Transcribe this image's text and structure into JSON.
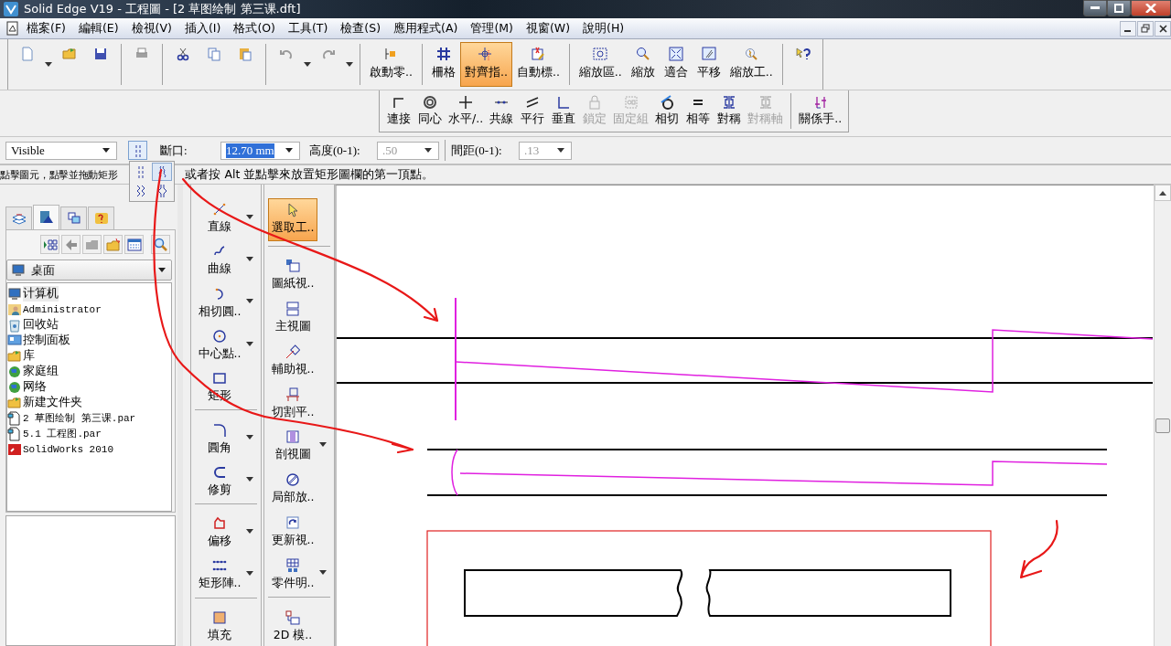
{
  "window": {
    "title": "Solid Edge V19 - 工程圖 - [2 草图绘制 第三课.dft]"
  },
  "menu": [
    "檔案(F)",
    "編輯(E)",
    "檢視(V)",
    "插入(I)",
    "格式(O)",
    "工具(T)",
    "檢查(S)",
    "應用程式(A)",
    "管理(M)",
    "視窗(W)",
    "說明(H)"
  ],
  "toolbar": [
    {
      "kind": "page",
      "dropdown": true,
      "selected": false
    },
    {
      "kind": "folder",
      "selected": false
    },
    {
      "kind": "disk",
      "selected": false
    },
    {
      "kind": "sep"
    },
    {
      "kind": "printer",
      "selected": false
    },
    {
      "kind": "sep"
    },
    {
      "kind": "scissors",
      "selected": false
    },
    {
      "kind": "copy",
      "selected": false
    },
    {
      "kind": "paste",
      "selected": false
    },
    {
      "kind": "sep"
    },
    {
      "kind": "undo",
      "dropdown": true,
      "selected": false
    },
    {
      "kind": "redo",
      "dropdown": true,
      "selected": false
    },
    {
      "kind": "sep"
    },
    {
      "kind": "flag",
      "label": "啟動零..",
      "selected": false
    },
    {
      "kind": "sep"
    },
    {
      "kind": "grid",
      "label": "柵格",
      "selected": false
    },
    {
      "kind": "target",
      "label": "對齊指..",
      "selected": true
    },
    {
      "kind": "tag",
      "label": "自動標..",
      "selected": false
    },
    {
      "kind": "sep"
    },
    {
      "kind": "zoombox",
      "label": "縮放區..",
      "selected": false
    },
    {
      "kind": "zoom",
      "label": "縮放",
      "selected": false
    },
    {
      "kind": "fit",
      "label": "適合",
      "selected": false
    },
    {
      "kind": "hand",
      "label": "平移",
      "selected": false
    },
    {
      "kind": "zoomtool",
      "label": "縮放工..",
      "selected": false
    },
    {
      "kind": "sep"
    },
    {
      "kind": "help",
      "selected": false
    }
  ],
  "relations": [
    {
      "kind": "connect",
      "label": "連接",
      "disabled": false
    },
    {
      "kind": "concentric",
      "label": "同心",
      "disabled": false
    },
    {
      "kind": "cross",
      "label": "水平/..",
      "disabled": false
    },
    {
      "kind": "collinear",
      "label": "共線",
      "disabled": false
    },
    {
      "kind": "parallel",
      "label": "平行",
      "disabled": false
    },
    {
      "kind": "perpendicular",
      "label": "垂直",
      "disabled": false
    },
    {
      "kind": "lock",
      "label": "鎖定",
      "disabled": true
    },
    {
      "kind": "rigid",
      "label": "固定組",
      "disabled": true
    },
    {
      "kind": "tangent",
      "label": "相切",
      "disabled": false
    },
    {
      "kind": "equal",
      "label": "相等",
      "disabled": false
    },
    {
      "kind": "symmetric",
      "label": "對稱",
      "disabled": false
    },
    {
      "kind": "symmetric",
      "label": "對稱軸",
      "disabled": true
    },
    {
      "kind": "sep"
    },
    {
      "kind": "handles",
      "label": "關係手..",
      "disabled": false
    }
  ],
  "ribbon": {
    "line_style": "Visible",
    "break_label": "斷口:",
    "break_value": "12.70 mm",
    "height_label": "高度(0-1):",
    "height_value": ".50",
    "height_disabled": true,
    "spacing_label": "間距(0-1):",
    "spacing_value": ".13",
    "spacing_disabled": true
  },
  "break_styles": [
    {
      "kind": "straight",
      "selected": false
    },
    {
      "kind": "wave",
      "selected": true
    },
    {
      "kind": "chevron",
      "selected": false
    },
    {
      "kind": "zigzag",
      "selected": false
    }
  ],
  "status": {
    "before": "點擊圖元，點擊並拖動矩形",
    "after": "或者按 Alt 並點擊來放置矩形圖欄的第一頂點。"
  },
  "library": {
    "tabs": [
      {
        "kind": "layers",
        "selected": false
      },
      {
        "kind": "library",
        "selected": true
      },
      {
        "kind": "groups",
        "selected": false
      },
      {
        "kind": "query",
        "selected": false
      }
    ],
    "location": "桌面",
    "files": [
      {
        "kind": "computer",
        "name": "计算机",
        "selected": true
      },
      {
        "kind": "user",
        "name": "Administrator",
        "selected": false
      },
      {
        "kind": "bin",
        "name": "回收站",
        "selected": false
      },
      {
        "kind": "panel",
        "name": "控制面板",
        "selected": false
      },
      {
        "kind": "folder",
        "name": "库",
        "selected": false
      },
      {
        "kind": "globe",
        "name": "家庭组",
        "selected": false
      },
      {
        "kind": "globe",
        "name": "网络",
        "selected": false
      },
      {
        "kind": "folder",
        "name": "新建文件夹",
        "selected": false
      },
      {
        "kind": "part",
        "name": "2 草图绘制 第三课.par",
        "selected": false
      },
      {
        "kind": "part",
        "name": "5.1 工程图.par",
        "selected": false
      },
      {
        "kind": "app",
        "name": "SolidWorks 2010",
        "selected": false
      }
    ]
  },
  "draw_tools": [
    {
      "kind": "line",
      "label": "直線",
      "dropdown": true
    },
    {
      "kind": "curve",
      "label": "曲線",
      "dropdown": true
    },
    {
      "kind": "arc",
      "label": "相切圓..",
      "dropdown": true
    },
    {
      "kind": "circle",
      "label": "中心點..",
      "dropdown": true
    },
    {
      "kind": "rectangle",
      "label": "矩形",
      "dropdown": false
    },
    {
      "kind": "sep"
    },
    {
      "kind": "fillet",
      "label": "圓角",
      "dropdown": true
    },
    {
      "kind": "trim",
      "label": "修剪",
      "dropdown": true
    },
    {
      "kind": "sep"
    },
    {
      "kind": "offset",
      "label": "偏移",
      "dropdown": true
    },
    {
      "kind": "pattern",
      "label": "矩形陣..",
      "dropdown": true
    },
    {
      "kind": "sep"
    },
    {
      "kind": "fill",
      "label": "填充",
      "dropdown": false
    }
  ],
  "view_tools": [
    {
      "kind": "pointer",
      "label": "選取工..",
      "dropdown": false,
      "selected": true
    },
    {
      "kind": "sep"
    },
    {
      "kind": "view",
      "label": "圖紙視..",
      "dropdown": false,
      "selected": false
    },
    {
      "kind": "mainview",
      "label": "主視圖",
      "dropdown": false,
      "selected": false
    },
    {
      "kind": "auxview",
      "label": "輔助視..",
      "dropdown": false,
      "selected": false
    },
    {
      "kind": "cutplane",
      "label": "切割平..",
      "dropdown": false,
      "selected": false
    },
    {
      "kind": "section",
      "label": "剖視圖",
      "dropdown": true,
      "selected": false
    },
    {
      "kind": "detail",
      "label": "局部放..",
      "dropdown": false,
      "selected": false
    },
    {
      "kind": "update",
      "label": "更新視..",
      "dropdown": false,
      "selected": false
    },
    {
      "kind": "table",
      "label": "零件明..",
      "dropdown": true,
      "selected": false
    },
    {
      "kind": "sep"
    },
    {
      "kind": "model",
      "label": "2D 模..",
      "dropdown": false,
      "selected": false
    }
  ]
}
